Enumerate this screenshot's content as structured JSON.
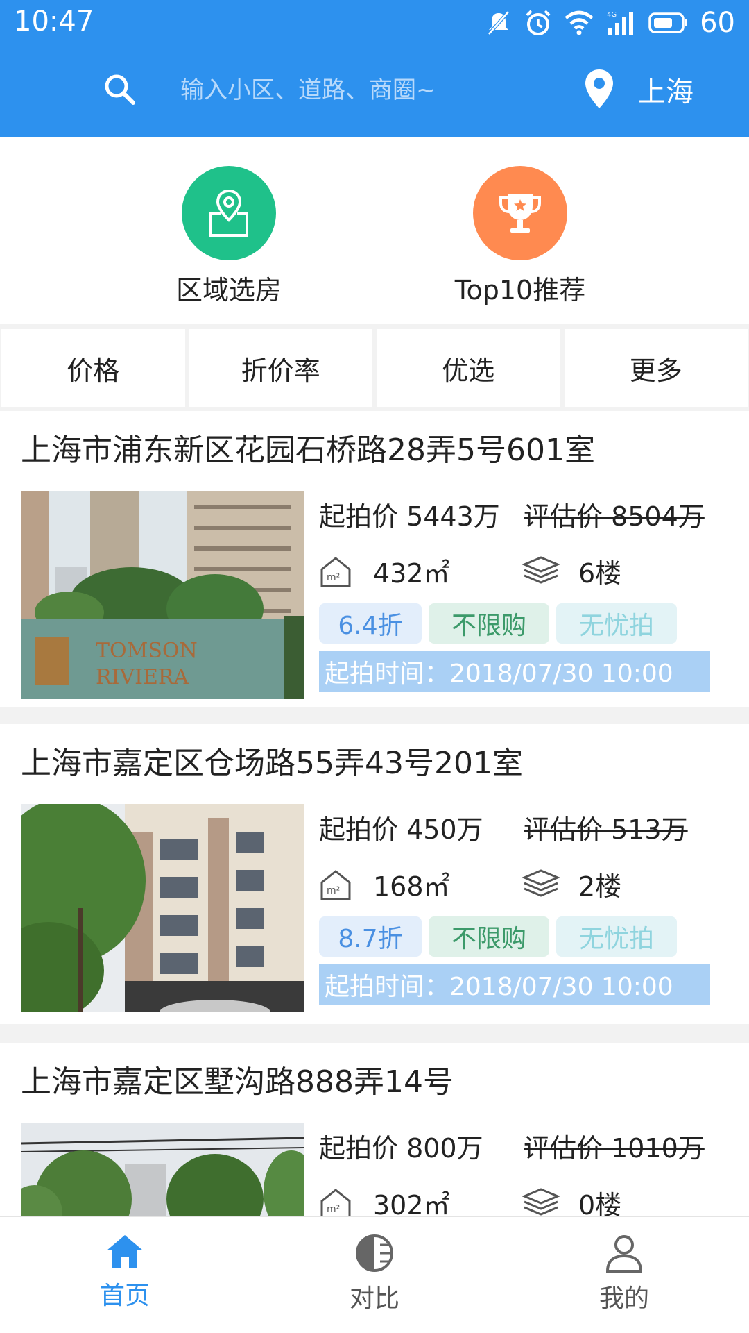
{
  "status_bar": {
    "time": "10:47",
    "battery": "60",
    "network": "4G"
  },
  "search": {
    "placeholder": "输入小区、道路、商圈~",
    "city": "上海"
  },
  "quick_entries": [
    {
      "label": "区域选房",
      "icon": "location-map-icon",
      "color": "#1fc18a"
    },
    {
      "label": "Top10推荐",
      "icon": "trophy-icon",
      "color": "#ff8a50"
    }
  ],
  "filters": [
    "价格",
    "折价率",
    "优选",
    "更多"
  ],
  "listings": [
    {
      "title": "上海市浦东新区花园石桥路28弄5号601室",
      "start_price": "起拍价 5443万",
      "eval_price": "评估价 8504万",
      "area": "432㎡",
      "floor": "6楼",
      "tags": [
        "6.4折",
        "不限购",
        "无忧拍"
      ],
      "auction_time": "起拍时间：2018/07/30 10:00",
      "photo_sign": [
        "TOMSON",
        "RIVIERA"
      ]
    },
    {
      "title": "上海市嘉定区仓场路55弄43号201室",
      "start_price": "起拍价 450万",
      "eval_price": "评估价 513万",
      "area": "168㎡",
      "floor": "2楼",
      "tags": [
        "8.7折",
        "不限购",
        "无忧拍"
      ],
      "auction_time": "起拍时间：2018/07/30 10:00"
    },
    {
      "title": "上海市嘉定区墅沟路888弄14号",
      "start_price": "起拍价 800万",
      "eval_price": "评估价 1010万",
      "area": "302㎡",
      "floor": "0楼"
    }
  ],
  "bottom_nav": [
    {
      "label": "首页",
      "icon": "home-icon",
      "active": true
    },
    {
      "label": "对比",
      "icon": "compare-icon",
      "active": false
    },
    {
      "label": "我的",
      "icon": "profile-icon",
      "active": false
    }
  ],
  "colors": {
    "primary": "#2d91ee",
    "green": "#1fc18a",
    "orange": "#ff8a50"
  }
}
